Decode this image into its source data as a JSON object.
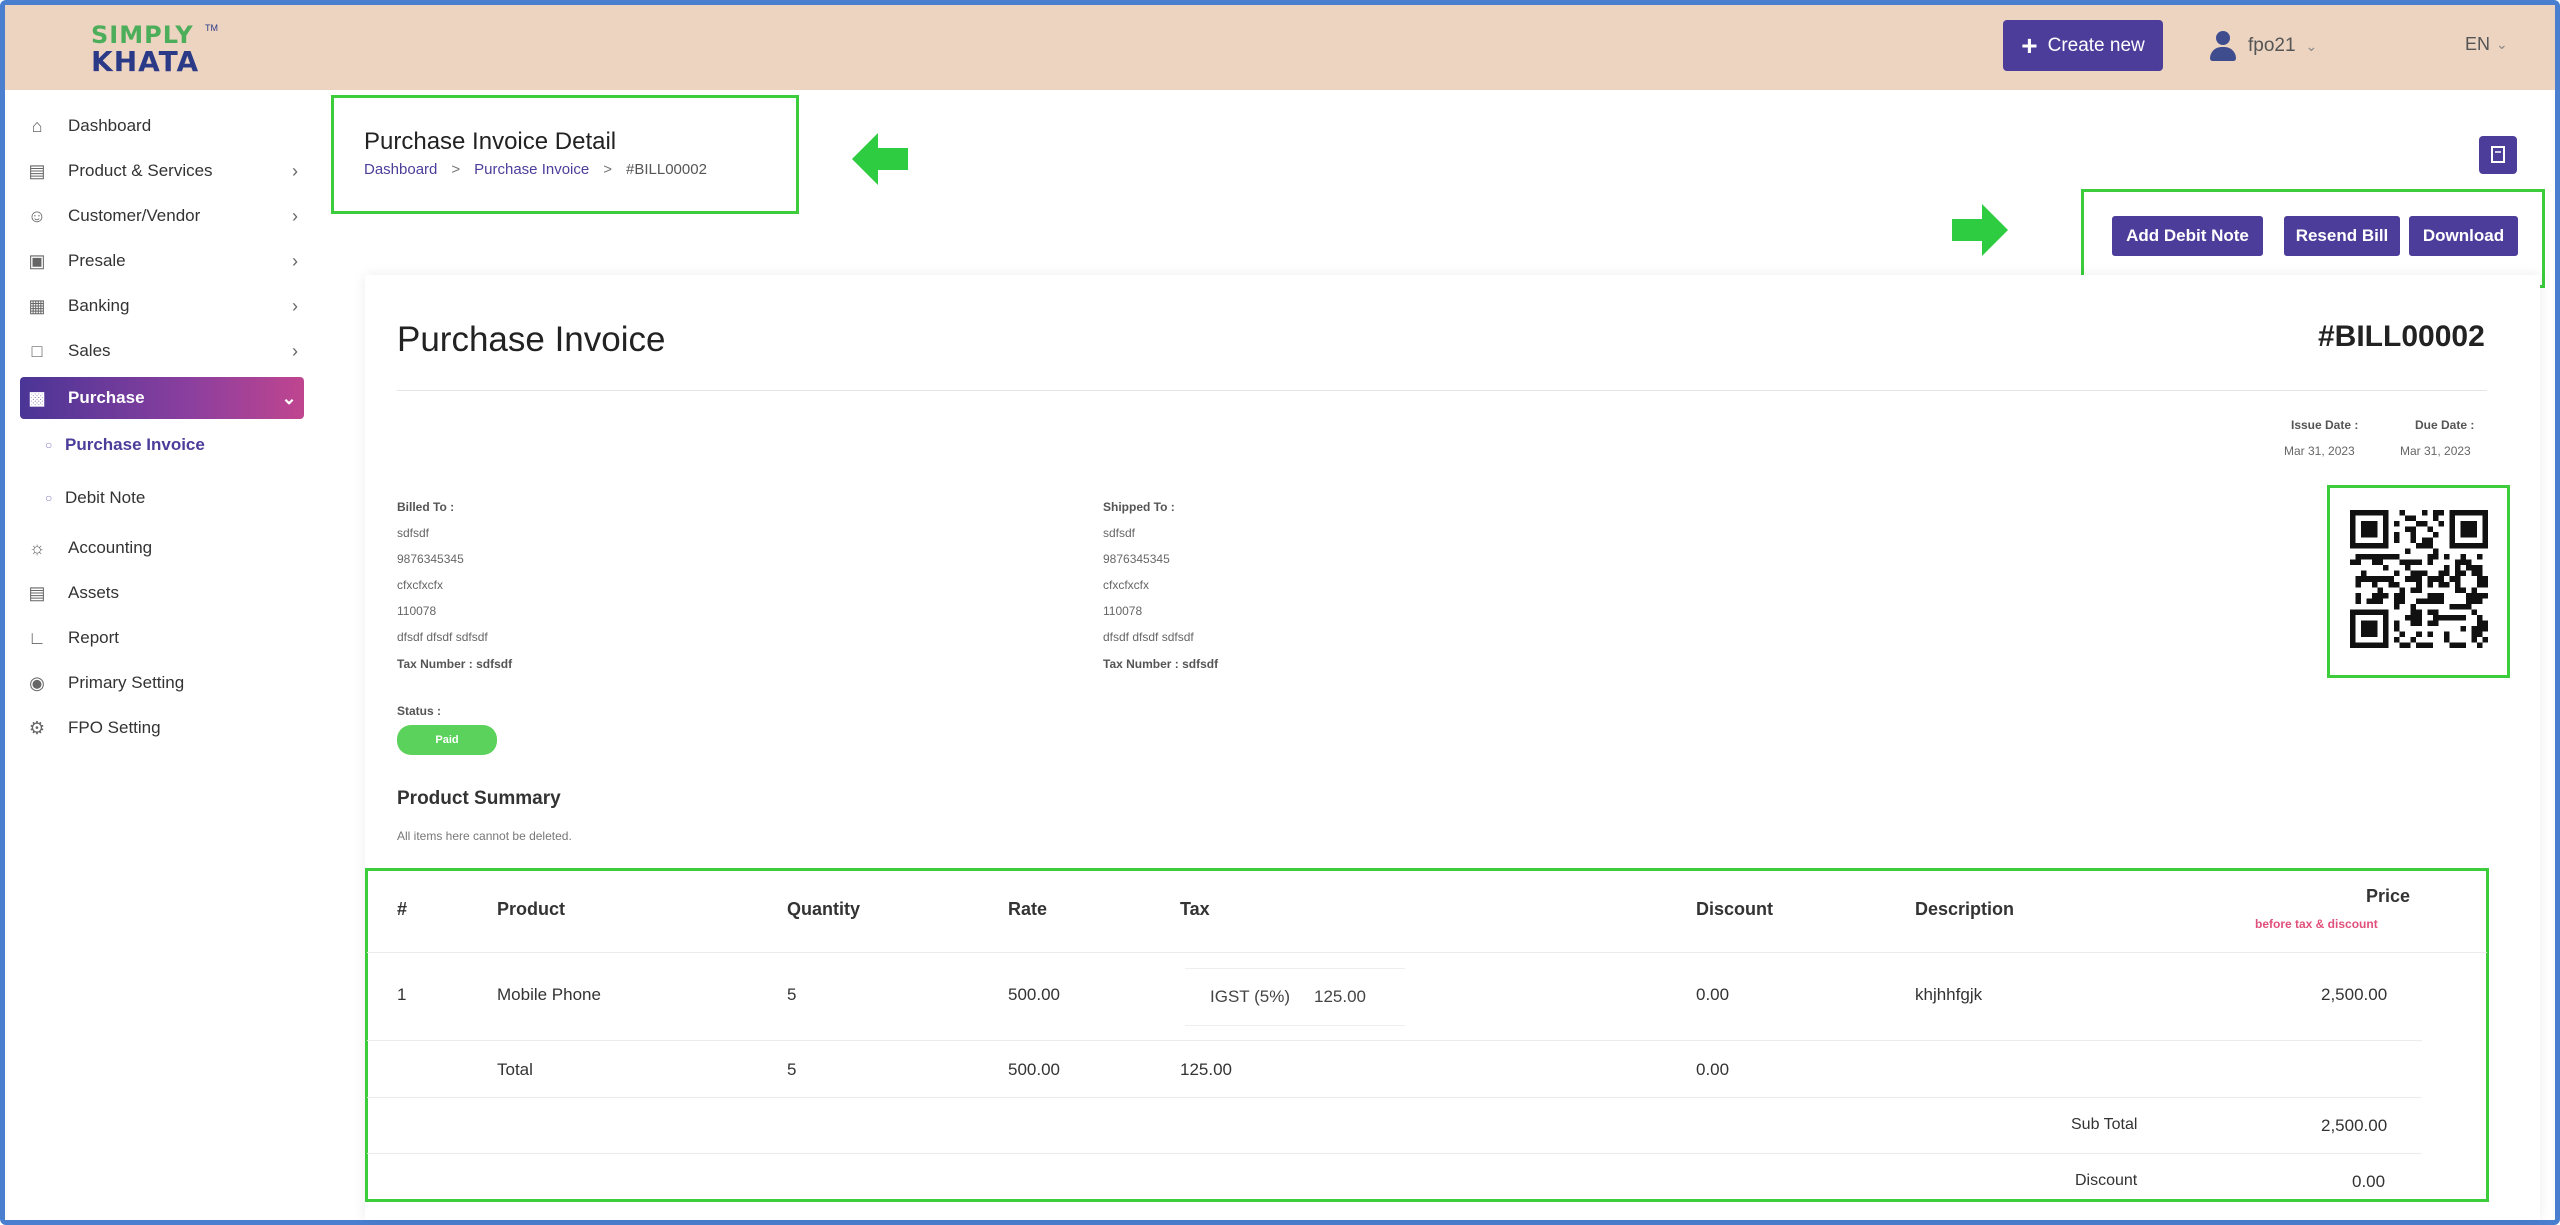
{
  "topbar": {
    "logo_top": "SIMPLY",
    "logo_bottom": "KHATA",
    "logo_tm": "TM",
    "create_label": "Create new",
    "user_name": "fpo21",
    "lang": "EN"
  },
  "sidebar": {
    "items": [
      {
        "label": "Dashboard",
        "icon": "home-icon"
      },
      {
        "label": "Product & Services",
        "icon": "cart-icon"
      },
      {
        "label": "Customer/Vendor",
        "icon": "user-add-icon"
      },
      {
        "label": "Presale",
        "icon": "briefcase-icon"
      },
      {
        "label": "Banking",
        "icon": "bank-icon"
      },
      {
        "label": "Sales",
        "icon": "document-icon"
      },
      {
        "label": "Purchase",
        "icon": "purchase-icon"
      },
      {
        "label": "Accounting",
        "icon": "accounting-icon"
      },
      {
        "label": "Assets",
        "icon": "assets-icon"
      },
      {
        "label": "Report",
        "icon": "report-icon"
      },
      {
        "label": "Primary Setting",
        "icon": "setting-icon"
      },
      {
        "label": "FPO Setting",
        "icon": "gear-icon"
      }
    ],
    "sub_items": [
      {
        "label": "Purchase Invoice"
      },
      {
        "label": "Debit Note"
      }
    ]
  },
  "header": {
    "title": "Purchase Invoice Detail",
    "breadcrumb": [
      "Dashboard",
      "Purchase Invoice",
      "#BILL00002"
    ]
  },
  "actions": {
    "add_debit_note": "Add Debit Note",
    "resend_bill": "Resend Bill",
    "download": "Download"
  },
  "invoice": {
    "title": "Purchase Invoice",
    "number": "#BILL00002",
    "issue_date_label": "Issue Date :",
    "issue_date": "Mar 31, 2023",
    "due_date_label": "Due Date :",
    "due_date": "Mar 31, 2023",
    "billed_to": {
      "label": "Billed To :",
      "lines": [
        "sdfsdf",
        "9876345345",
        "cfxcfxcfx",
        "110078",
        "dfsdf dfsdf sdfsdf",
        "Tax Number : sdfsdf"
      ]
    },
    "shipped_to": {
      "label": "Shipped To :",
      "lines": [
        "sdfsdf",
        "9876345345",
        "cfxcfxcfx",
        "110078",
        "dfsdf dfsdf sdfsdf",
        "Tax Number : sdfsdf"
      ]
    },
    "status_label": "Status :",
    "status": "Paid",
    "product_summary_title": "Product Summary",
    "product_summary_note": "All items here cannot be deleted.",
    "columns": {
      "num": "#",
      "product": "Product",
      "quantity": "Quantity",
      "rate": "Rate",
      "tax": "Tax",
      "discount": "Discount",
      "description": "Description",
      "price": "Price",
      "price_note": "before tax & discount"
    },
    "rows": [
      {
        "num": "1",
        "product": "Mobile Phone",
        "quantity": "5",
        "rate": "500.00",
        "tax_name": "IGST (5%)",
        "tax_value": "125.00",
        "discount": "0.00",
        "description": "khjhhfgjk",
        "price": "2,500.00"
      }
    ],
    "total": {
      "label": "Total",
      "quantity": "5",
      "rate": "500.00",
      "tax": "125.00",
      "discount": "0.00"
    },
    "subtotal_label": "Sub Total",
    "subtotal": "2,500.00",
    "discount_label": "Discount",
    "discount_total": "0.00"
  },
  "colors": {
    "accent": "#4d3d9b",
    "highlight": "#3ccc3c",
    "paid": "#5bd25b",
    "topbar": "#ecd4c1"
  }
}
